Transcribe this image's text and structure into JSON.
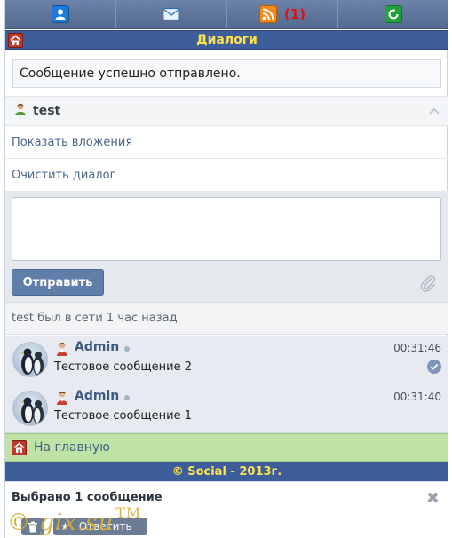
{
  "nav": {
    "items": [
      {
        "name": "profile",
        "icon": "profile-icon"
      },
      {
        "name": "mail",
        "icon": "mail-icon"
      },
      {
        "name": "feed",
        "icon": "rss-icon",
        "badge": "(1)"
      },
      {
        "name": "refresh",
        "icon": "refresh-icon"
      }
    ]
  },
  "header": {
    "title": "Диалоги",
    "home_icon": "home-icon"
  },
  "notice": "Сообщение успешно отправлено.",
  "dialog": {
    "username": "test",
    "show_attachments": "Показать вложения",
    "clear_dialog": "Очистить диалог"
  },
  "composer": {
    "send_label": "Отправить",
    "attach_icon": "paperclip-icon"
  },
  "status_text": "test был в сети 1 час назад",
  "messages": [
    {
      "author": "Admin",
      "time": "00:31:46",
      "text": "Тестовое сообщение 2",
      "selected": true
    },
    {
      "author": "Admin",
      "time": "00:31:40",
      "text": "Тестовое сообщение 1",
      "selected": false
    }
  ],
  "home_link": "На главную",
  "footer": "© Social - 2013г.",
  "selection": {
    "text": "Выбрано 1 сообщение",
    "reply_label": "Ответить"
  },
  "watermark": {
    "text": "© gix.su",
    "mark": "TM"
  },
  "colors": {
    "header_bg": "#3d5e9b",
    "header_text": "#ffe34d",
    "home_bar_bg": "#bfe3a6",
    "button_bg": "#5f7ea9",
    "badge": "#e01010"
  }
}
